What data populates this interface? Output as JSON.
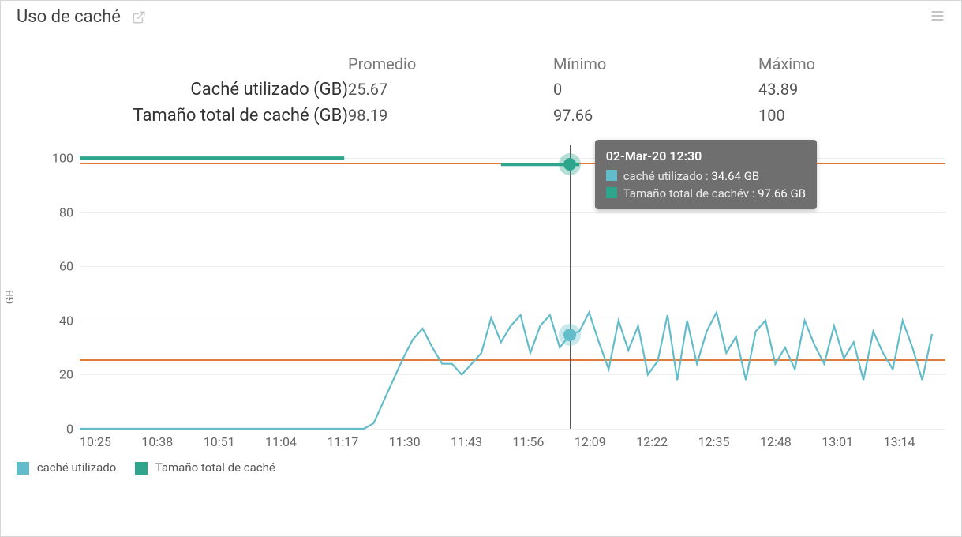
{
  "header": {
    "title": "Uso de caché"
  },
  "stats": {
    "columns": [
      "Promedio",
      "Mínimo",
      "Máximo"
    ],
    "rows": [
      {
        "label": "Caché utilizado (GB)",
        "avg": "25.67",
        "min": "0",
        "max": "43.89"
      },
      {
        "label": "Tamaño total de caché (GB)",
        "avg": "98.19",
        "min": "97.66",
        "max": "100"
      }
    ]
  },
  "legend": {
    "items": [
      {
        "label": "caché utilizado",
        "swatchStyle": "background:#63bcc9"
      },
      {
        "label": "Tamaño total de caché",
        "swatchStyle": "background:#2fa58d"
      }
    ]
  },
  "colors": {
    "used": "#63bcc9",
    "total": "#2fa58d",
    "reference": "#e07b3a",
    "tooltip_bg": "#6f6f6f"
  },
  "tooltip": {
    "date": "02-Mar-20 12:30",
    "rows": [
      {
        "swatch": "#63bcc9",
        "label": "caché utilizado :",
        "value": "34.64 GB"
      },
      {
        "swatch": "#2fa58d",
        "label": "Tamaño total de cachév :",
        "value": "97.66 GB"
      }
    ]
  },
  "chart_data": {
    "type": "line",
    "title": "Uso de caché",
    "ylabel": "GB",
    "xlabel": "",
    "ylim": [
      0,
      105
    ],
    "yticks": [
      0,
      20,
      40,
      60,
      80,
      100
    ],
    "reference_lines": [
      25.67,
      98.19
    ],
    "x_tick_labels": [
      "10:25",
      "10:38",
      "10:51",
      "11:04",
      "11:17",
      "11:30",
      "11:43",
      "11:56",
      "12:09",
      "12:22",
      "12:35",
      "12:48",
      "13:01",
      "13:14"
    ],
    "hover_index": 50,
    "series": [
      {
        "name": "caché utilizado",
        "color": "#63bcc9",
        "values": [
          0,
          0,
          0,
          0,
          0,
          0,
          0,
          0,
          0,
          0,
          0,
          0,
          0,
          0,
          0,
          0,
          0,
          0,
          0,
          0,
          0,
          0,
          0,
          0,
          0,
          0,
          0,
          0,
          0,
          0,
          2,
          10,
          18,
          26,
          33,
          37,
          30,
          24,
          24,
          20,
          24,
          28,
          41,
          32,
          38,
          42,
          28,
          38,
          42,
          30,
          34.64,
          36,
          43,
          32,
          22,
          40,
          29,
          38,
          20,
          25,
          42,
          18,
          40,
          24,
          36,
          43,
          28,
          34,
          18,
          36,
          40,
          24,
          30,
          22,
          40,
          31,
          24,
          38,
          26,
          32,
          18,
          36,
          28,
          22,
          40,
          30,
          18,
          35
        ]
      },
      {
        "name": "Tamaño total de caché",
        "color": "#2fa58d",
        "values": [
          100,
          100,
          100,
          100,
          100,
          100,
          100,
          100,
          100,
          100,
          100,
          100,
          100,
          100,
          100,
          100,
          100,
          100,
          100,
          100,
          100,
          100,
          100,
          100,
          100,
          100,
          100,
          100,
          null,
          null,
          null,
          null,
          null,
          null,
          null,
          null,
          null,
          null,
          null,
          null,
          null,
          null,
          null,
          97.66,
          97.66,
          97.66,
          97.66,
          97.66,
          97.66,
          97.66,
          97.66,
          97.66,
          null,
          null,
          null,
          null,
          null,
          null,
          null,
          null,
          null,
          null,
          null,
          null,
          null,
          null,
          null,
          null,
          null,
          null,
          null,
          null,
          null,
          null,
          null,
          null,
          null,
          null,
          null,
          null,
          null,
          null,
          null,
          null,
          null,
          null,
          null,
          null,
          null
        ]
      }
    ]
  }
}
